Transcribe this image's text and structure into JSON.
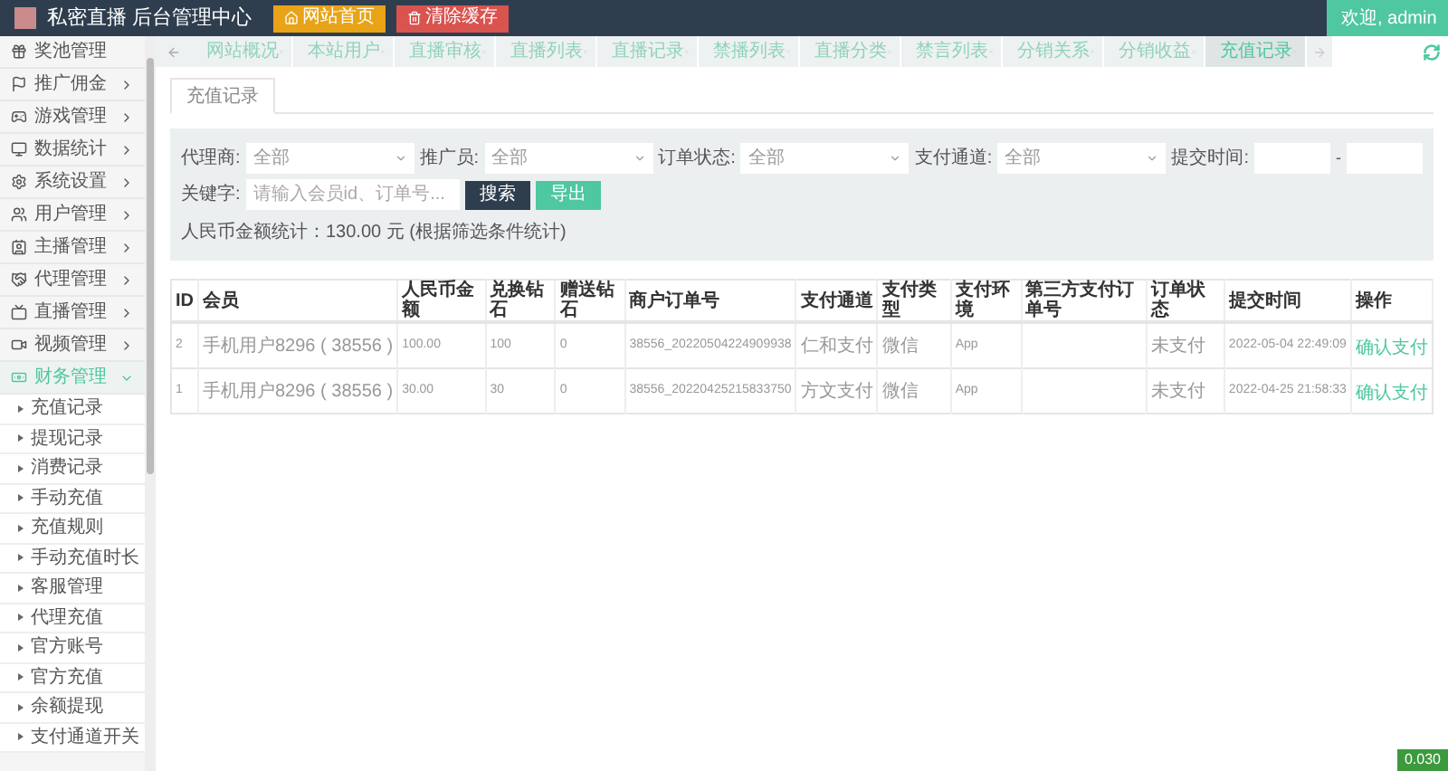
{
  "header": {
    "title": "私密直播 后台管理中心",
    "buttons": [
      {
        "label": "网站首页",
        "kind": "home"
      },
      {
        "label": "清除缓存",
        "kind": "clear"
      }
    ],
    "user": "欢迎, admin"
  },
  "sidebar": {
    "items": [
      {
        "label": "奖池管理",
        "expandable": false,
        "expanded": false
      },
      {
        "label": "推广佣金",
        "expandable": true,
        "expanded": false
      },
      {
        "label": "游戏管理",
        "expandable": true,
        "expanded": false
      },
      {
        "label": "数据统计",
        "expandable": true,
        "expanded": false
      },
      {
        "label": "系统设置",
        "expandable": true,
        "expanded": false
      },
      {
        "label": "用户管理",
        "expandable": true,
        "expanded": false
      },
      {
        "label": "主播管理",
        "expandable": true,
        "expanded": false
      },
      {
        "label": "代理管理",
        "expandable": true,
        "expanded": false
      },
      {
        "label": "直播管理",
        "expandable": true,
        "expanded": false
      },
      {
        "label": "视频管理",
        "expandable": true,
        "expanded": false
      },
      {
        "label": "财务管理",
        "expandable": true,
        "expanded": true,
        "children": [
          "充值记录",
          "提现记录",
          "消费记录",
          "手动充值",
          "充值规则",
          "手动充值时长",
          "客服管理",
          "代理充值",
          "官方账号",
          "官方充值",
          "余额提现",
          "支付通道开关"
        ]
      }
    ]
  },
  "tabs": [
    {
      "label": "网站概况",
      "selected": false
    },
    {
      "label": "本站用户",
      "selected": false
    },
    {
      "label": "直播审核",
      "selected": false
    },
    {
      "label": "直播列表",
      "selected": false
    },
    {
      "label": "直播记录",
      "selected": false
    },
    {
      "label": "禁播列表",
      "selected": false
    },
    {
      "label": "直播分类",
      "selected": false
    },
    {
      "label": "禁言列表",
      "selected": false
    },
    {
      "label": "分销关系",
      "selected": false
    },
    {
      "label": "分销收益",
      "selected": false
    },
    {
      "label": "充值记录",
      "selected": true
    }
  ],
  "page_tab": "充值记录",
  "filters": {
    "fields": [
      {
        "label": "代理商:",
        "kind": "select",
        "value": "全部"
      },
      {
        "label": "推广员:",
        "kind": "select",
        "value": "全部"
      },
      {
        "label": "订单状态:",
        "kind": "select",
        "value": "全部"
      },
      {
        "label": "支付通道:",
        "kind": "select",
        "value": "全部"
      },
      {
        "label": "提交时间:",
        "kind": "daterange",
        "separator": "-"
      }
    ],
    "keyword": {
      "label": "关键字:",
      "placeholder": "请输入会员id、订单号..."
    },
    "search_button": "搜索",
    "export_button": "导出",
    "summary": "人民币金额统计：130.00 元 (根据筛选条件统计)"
  },
  "table": {
    "columns": [
      "ID",
      "会员",
      "人民币金额",
      "兑换钻石",
      "赠送钻石",
      "商户订单号",
      "支付通道",
      "支付类型",
      "支付环境",
      "第三方支付订单号",
      "订单状态",
      "提交时间",
      "操作"
    ],
    "rows": [
      {
        "cells": [
          "2",
          "手机用户8296 ( 38556 )",
          "100.00",
          "100",
          "0",
          "38556_20220504224909938",
          "仁和支付",
          "微信",
          "App",
          "",
          "未支付",
          "2022-05-04 22:49:09"
        ],
        "action": "确认支付"
      },
      {
        "cells": [
          "1",
          "手机用户8296 ( 38556 )",
          "30.00",
          "30",
          "0",
          "38556_20220425215833750",
          "方文支付",
          "微信",
          "App",
          "",
          "未支付",
          "2022-04-25 21:58:33"
        ],
        "action": "确认支付"
      }
    ]
  },
  "corner_badge": "0.030"
}
